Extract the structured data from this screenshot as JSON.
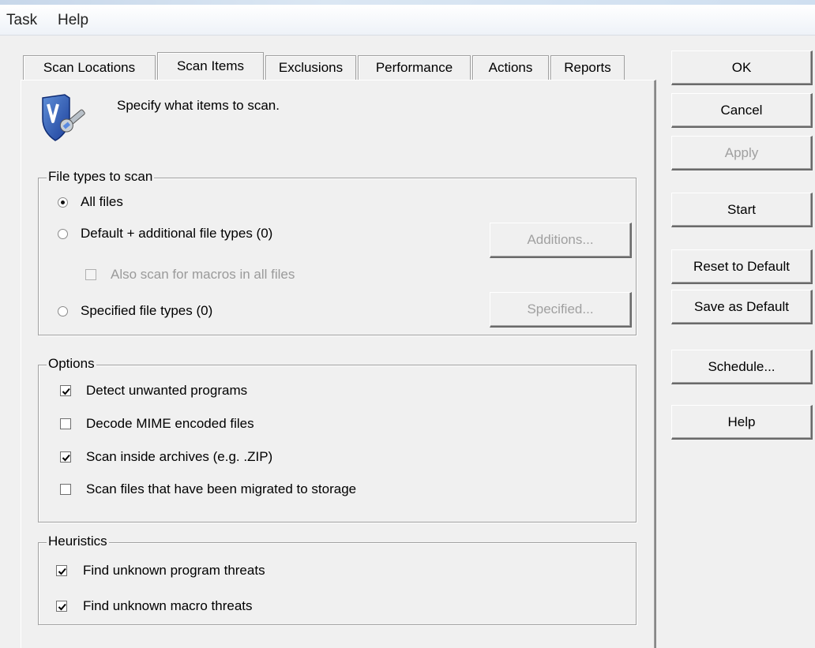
{
  "menu": {
    "task": "Task",
    "help": "Help"
  },
  "tabs": [
    {
      "label": "Scan Locations",
      "active": false
    },
    {
      "label": "Scan Items",
      "active": true
    },
    {
      "label": "Exclusions",
      "active": false
    },
    {
      "label": "Performance",
      "active": false
    },
    {
      "label": "Actions",
      "active": false
    },
    {
      "label": "Reports",
      "active": false
    }
  ],
  "header": {
    "description": "Specify what items to scan.",
    "icon": "shield-wrench-icon"
  },
  "file_types": {
    "legend": "File types to scan",
    "all_files": "All files",
    "default_additional": "Default + additional file types (0)",
    "also_scan_macros": "Also scan for macros in all files",
    "specified": "Specified file types (0)",
    "additions_button": "Additions...",
    "specified_button": "Specified...",
    "selected": "all_files"
  },
  "options": {
    "legend": "Options",
    "items": [
      {
        "label": "Detect unwanted programs",
        "checked": true
      },
      {
        "label": "Decode MIME encoded files",
        "checked": false
      },
      {
        "label": "Scan inside archives (e.g. .ZIP)",
        "checked": true
      },
      {
        "label": "Scan files that have been migrated to storage",
        "checked": false
      }
    ]
  },
  "heuristics": {
    "legend": "Heuristics",
    "items": [
      {
        "label": "Find unknown program threats",
        "checked": true
      },
      {
        "label": "Find unknown macro threats",
        "checked": true
      }
    ]
  },
  "buttons": {
    "ok": "OK",
    "cancel": "Cancel",
    "apply": "Apply",
    "start": "Start",
    "reset_default": "Reset to Default",
    "save_default": "Save as Default",
    "schedule": "Schedule...",
    "help": "Help"
  }
}
